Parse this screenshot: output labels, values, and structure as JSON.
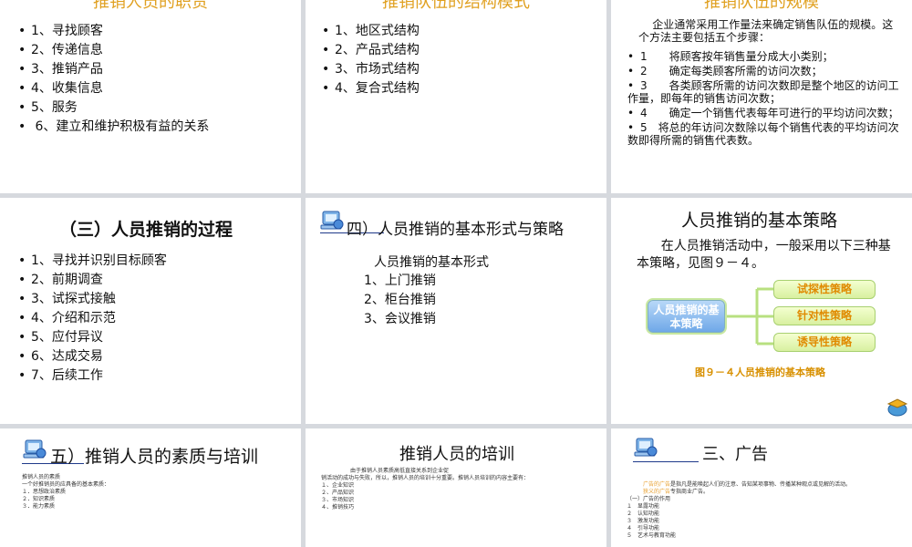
{
  "slides": {
    "s1": {
      "title": "推销人员的职责",
      "items": [
        "1、寻找顾客",
        "2、传递信息",
        "3、推销产品",
        "4、收集信息",
        "5、服务",
        "6、建立和维护积极有益的关系"
      ]
    },
    "s2": {
      "title": "推销队伍的结构模式",
      "items": [
        "1、地区式结构",
        "2、产品式结构",
        "3、市场式结构",
        "4、复合式结构"
      ]
    },
    "s3": {
      "title": "推销队伍的规模",
      "intro": "企业通常采用工作量法来确定销售队伍的规模。这个方法主要包括五个步骤：",
      "items": [
        "1　　将顾客按年销售量分成大小类别；",
        "2　　确定每类顾客所需的访问次数；",
        "3　　各类顾客所需的访问次数即是整个地区的访问工作量，即每年的销售访问次数；",
        "4　　确定一个销售代表每年可进行的平均访问次数；",
        "5　将总的年访问次数除以每个销售代表的平均访问次数即得所需的销售代表数。"
      ]
    },
    "s4": {
      "title": "（三）人员推销的过程",
      "items": [
        "1、寻找并识别目标顾客",
        "2、前期调查",
        "3、试探式接触",
        "4、介绍和示范",
        "5、应付异议",
        "6、达成交易",
        "7、后续工作"
      ]
    },
    "s5": {
      "title": "四）人员推销的基本形式与策略",
      "sub": "人员推销的基本形式",
      "items": [
        "1、上门推销",
        "2、柜台推销",
        "3、会议推销"
      ]
    },
    "s6": {
      "title": "人员推销的基本策略",
      "body": "在人员推销活动中，一般采用以下三种基本策略，见图９－４。",
      "center": "人员推销的基本策略",
      "options": [
        "试探性策略",
        "针对性策略",
        "诱导性策略"
      ],
      "caption": "图９－４人员推销的基本策略"
    },
    "s7": {
      "title": "五）推销人员的素质与培训",
      "lines": [
        "推销人员的素质",
        "一个好推销员的应具备的基本素质：",
        "１．思想政治素质",
        "２．知识素质",
        "３．能力素质"
      ]
    },
    "s8": {
      "title": "推销人员的培训",
      "lines": [
        "由于推销人员素质高低直接关系到企业促",
        "销活动的成功与失败，所以，推销人员的培训十分重要。推销人员培训的内容主要有：",
        "１、企业知识",
        "２、产品知识",
        "３、市场知识",
        "４、推销技巧"
      ]
    },
    "s9": {
      "title": "三、广告",
      "line1_hl": "广告的广告",
      "line1": "是指凡是能唤起人们的注意、告知某项事物、传播某种观点或见解的活动。",
      "line2_hl": "狭义的广告",
      "line2": "专指商业广告。",
      "lines": [
        "（一）广告的作用",
        "１　显露功能",
        "２　认知功能",
        "３　激发功能",
        "４　引导功能",
        "５　艺术与教育功能"
      ]
    }
  },
  "colors": {
    "title_cut": "#e0a020",
    "option_text": "#e08a00",
    "caption": "#d89000"
  },
  "icons": {
    "slide_icon": "computer-globe-icon",
    "corner": "graduation-cap-icon"
  }
}
